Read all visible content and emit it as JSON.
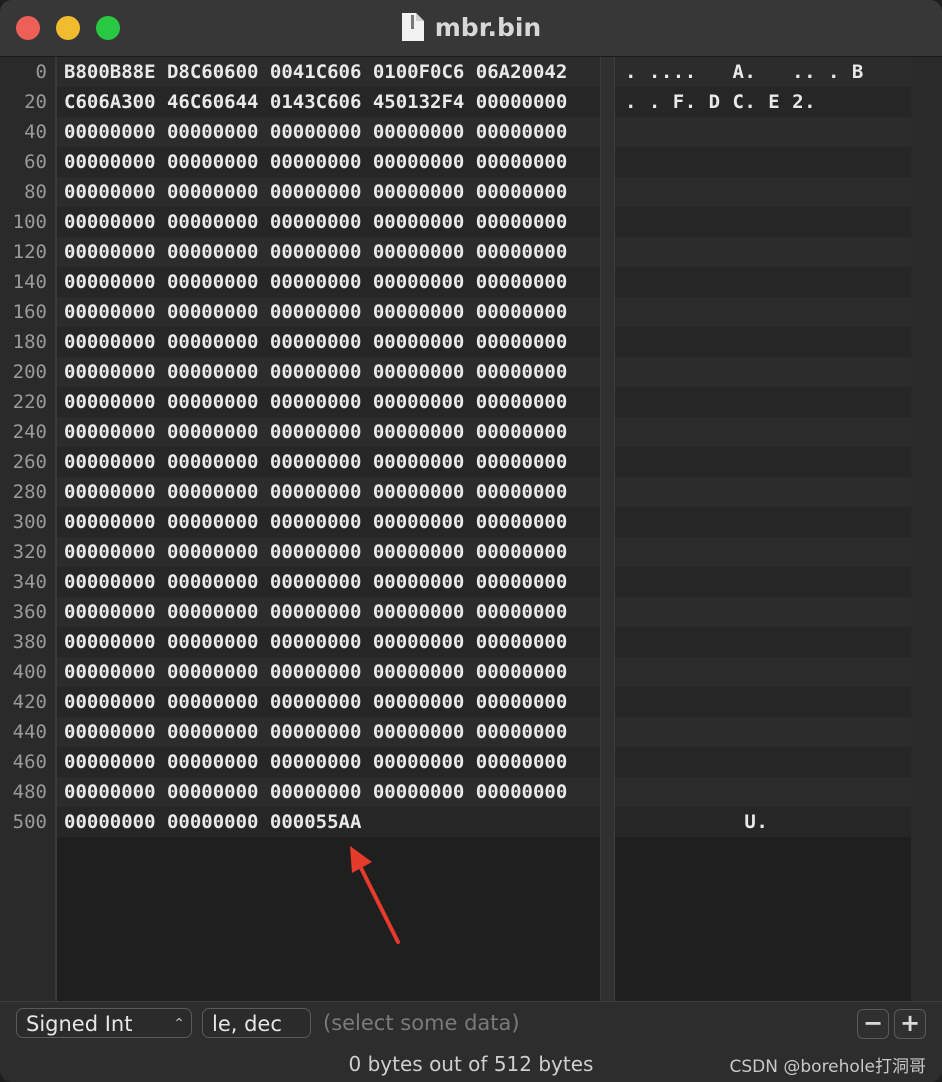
{
  "window": {
    "title": "mbr.bin",
    "icon": "document-icon"
  },
  "offsets": [
    "0",
    "20",
    "40",
    "60",
    "80",
    "100",
    "120",
    "140",
    "160",
    "180",
    "200",
    "220",
    "240",
    "260",
    "280",
    "300",
    "320",
    "340",
    "360",
    "380",
    "400",
    "420",
    "440",
    "460",
    "480",
    "500"
  ],
  "hex_rows": [
    "B800B88E D8C60600 0041C606 0100F0C6 06A20042",
    "C606A300 46C60644 0143C606 450132F4 00000000",
    "00000000 00000000 00000000 00000000 00000000",
    "00000000 00000000 00000000 00000000 00000000",
    "00000000 00000000 00000000 00000000 00000000",
    "00000000 00000000 00000000 00000000 00000000",
    "00000000 00000000 00000000 00000000 00000000",
    "00000000 00000000 00000000 00000000 00000000",
    "00000000 00000000 00000000 00000000 00000000",
    "00000000 00000000 00000000 00000000 00000000",
    "00000000 00000000 00000000 00000000 00000000",
    "00000000 00000000 00000000 00000000 00000000",
    "00000000 00000000 00000000 00000000 00000000",
    "00000000 00000000 00000000 00000000 00000000",
    "00000000 00000000 00000000 00000000 00000000",
    "00000000 00000000 00000000 00000000 00000000",
    "00000000 00000000 00000000 00000000 00000000",
    "00000000 00000000 00000000 00000000 00000000",
    "00000000 00000000 00000000 00000000 00000000",
    "00000000 00000000 00000000 00000000 00000000",
    "00000000 00000000 00000000 00000000 00000000",
    "00000000 00000000 00000000 00000000 00000000",
    "00000000 00000000 00000000 00000000 00000000",
    "00000000 00000000 00000000 00000000 00000000",
    "00000000 00000000 00000000 00000000 00000000",
    "00000000 00000000 000055AA"
  ],
  "ascii_rows": [
    ". ....   A.   .. . B",
    ". . F. D C. E 2.",
    "",
    "",
    "",
    "",
    "",
    "",
    "",
    "",
    "",
    "",
    "",
    "",
    "",
    "",
    "",
    "",
    "",
    "",
    "",
    "",
    "",
    "",
    "",
    "          U."
  ],
  "footer": {
    "type_select": "Signed Int",
    "encoding_field": "le, dec",
    "hint": "(select some data)",
    "minus_label": "−",
    "plus_label": "+",
    "status": "0 bytes out of 512 bytes",
    "watermark": "CSDN @borehole打洞哥"
  },
  "colors": {
    "annotation_arrow": "#e53b2c",
    "close": "#ee5f57",
    "minimize": "#f2bc2f",
    "maximize": "#29c841"
  }
}
